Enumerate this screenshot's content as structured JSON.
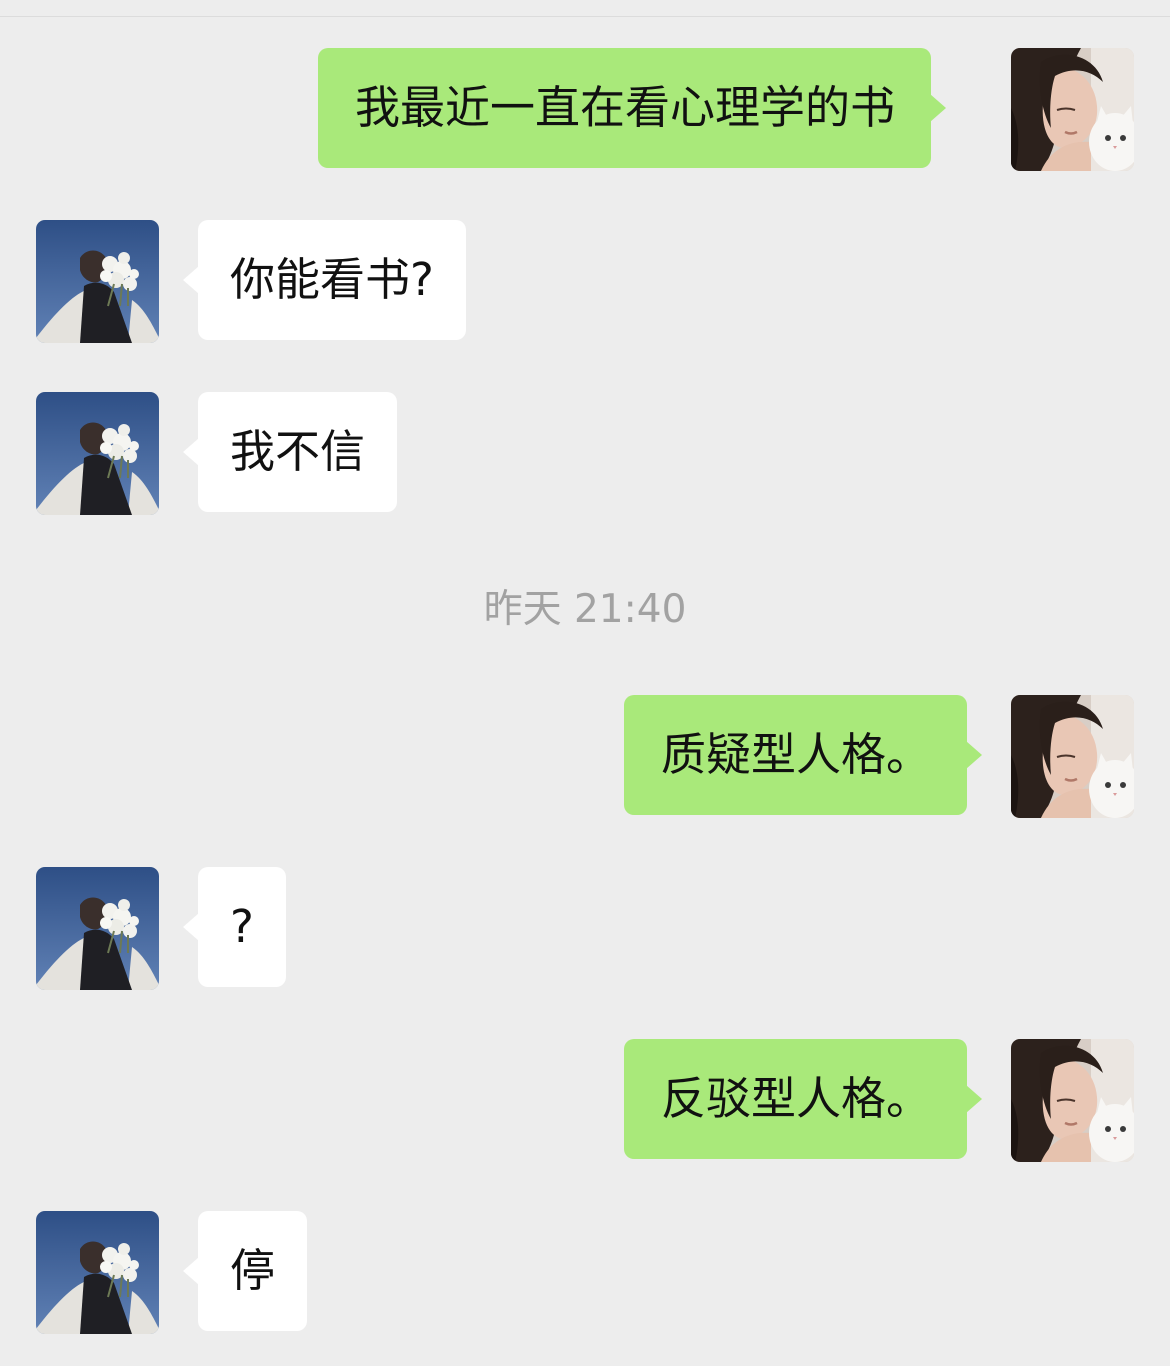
{
  "messages": [
    {
      "from": "me",
      "text": "我最近一直在看心理学的书"
    },
    {
      "from": "them",
      "text": "你能看书?"
    },
    {
      "from": "them",
      "text": "我不信"
    },
    {
      "from": "me",
      "text": "质疑型人格。"
    },
    {
      "from": "them",
      "text": "?"
    },
    {
      "from": "me",
      "text": "反驳型人格。"
    },
    {
      "from": "them",
      "text": "停"
    }
  ],
  "timestamp": "昨天 21:40",
  "colors": {
    "background": "#ededed",
    "sent_bubble": "#a9e97a",
    "received_bubble": "#ffffff",
    "timestamp_text": "#a2a2a2"
  },
  "icons": {
    "my_avatar": "avatar-girl-with-cat-icon",
    "their_avatar": "avatar-person-with-flowers-icon"
  }
}
